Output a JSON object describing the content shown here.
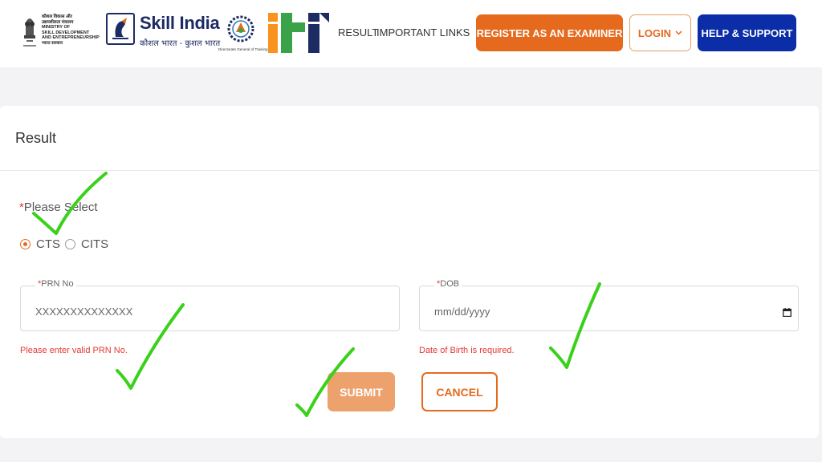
{
  "header": {
    "ministry": {
      "lines": [
        "कौशल विकास और",
        "उद्यमशीलता मंत्रालय",
        "MINISTRY OF",
        "SKILL DEVELOPMENT",
        "AND ENTREPRENEURSHIP",
        "भारत सरकार"
      ]
    },
    "skill_india": {
      "title": "Skill India",
      "subtitle": "कौशल भारत - कुशल भारत"
    },
    "dgt_caption": "Directorate General of Training",
    "iti_logo_text": "iti",
    "nav": {
      "result_label": "RESULT",
      "important_links_label": "IMPORTANT LINKS"
    },
    "register_label": "REGISTER AS AN EXAMINER",
    "login_label": "LOGIN",
    "help_label": "HELP & SUPPORT",
    "brand_orange": "#e56a1d",
    "brand_blue": "#0b2ea8"
  },
  "form": {
    "title": "Result",
    "please_select": "Please Select",
    "options": [
      {
        "label": "CTS",
        "checked": true
      },
      {
        "label": "CITS",
        "checked": false
      }
    ],
    "prn": {
      "label": "PRN No",
      "placeholder": "XXXXXXXXXXXXXX",
      "error": "Please enter valid PRN No."
    },
    "dob": {
      "label": "DOB",
      "placeholder": "mm/dd/yyyy",
      "error": "Date of Birth is required."
    },
    "submit_label": "SUBMIT",
    "cancel_label": "CANCEL",
    "error_color": "#e53935"
  },
  "annotations": {
    "checkmark_color": "#3ad11a",
    "checkmark_count": 5
  }
}
